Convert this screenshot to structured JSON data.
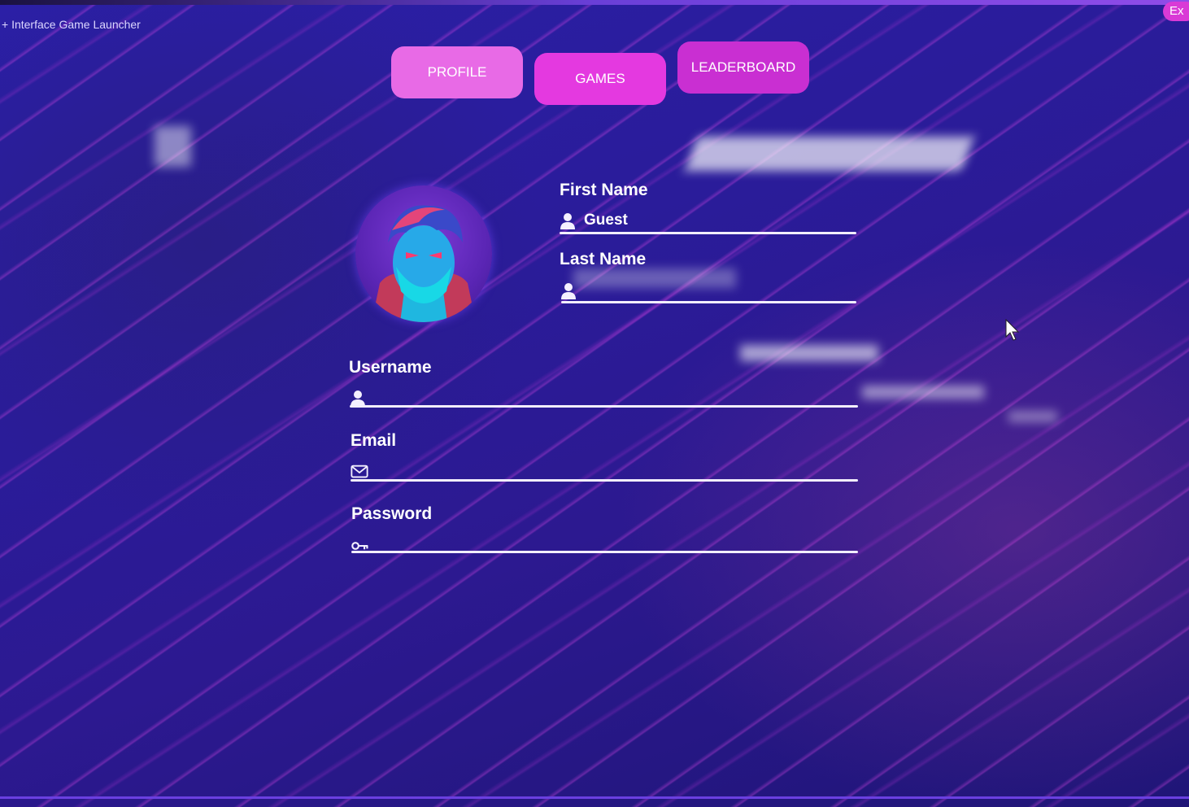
{
  "window": {
    "title": "Interface Game Launcher",
    "exit_label": "Ex"
  },
  "tabs": [
    {
      "label": "PROFILE"
    },
    {
      "label": "GAMES"
    },
    {
      "label": "LEADERBOARD"
    }
  ],
  "profile": {
    "avatar_icon": "avatar-portrait",
    "first_name": {
      "label": "First Name",
      "value": "Guest",
      "icon": "user-icon"
    },
    "last_name": {
      "label": "Last Name",
      "value": "",
      "icon": "user-icon"
    },
    "username": {
      "label": "Username",
      "value": "",
      "icon": "user-icon"
    },
    "email": {
      "label": "Email",
      "value": "",
      "icon": "envelope-icon"
    },
    "password": {
      "label": "Password",
      "value": "",
      "icon": "key-icon"
    }
  },
  "colors": {
    "background": "#2a1c9a",
    "accent_pink": "#e439e0",
    "accent_light_pink": "#e86ae6",
    "accent_purple": "#c92fd2",
    "text": "#ffffff"
  }
}
